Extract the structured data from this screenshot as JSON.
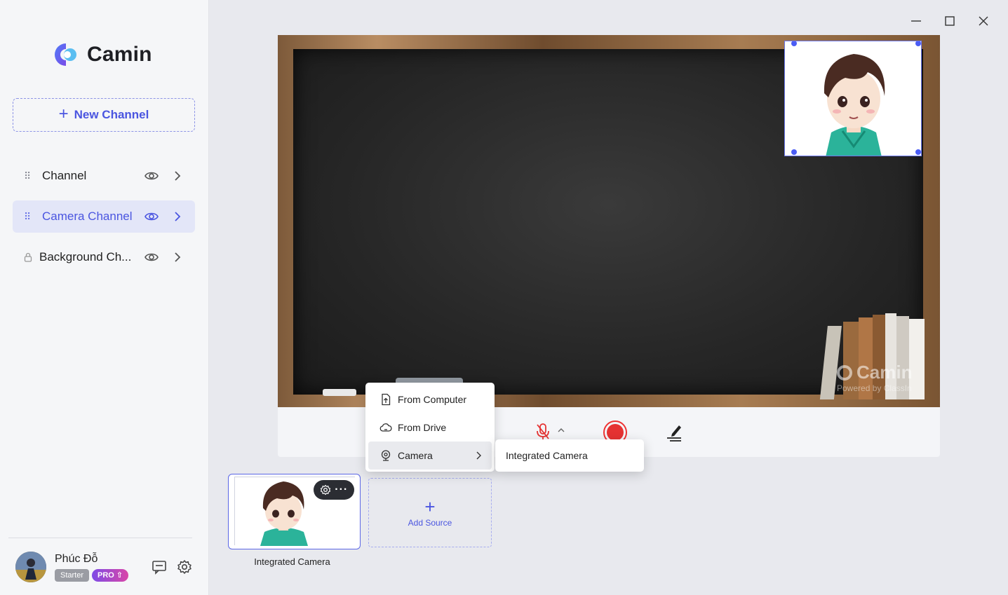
{
  "app": {
    "name": "Camin"
  },
  "sidebar": {
    "new_channel_label": "New Channel",
    "channels": [
      {
        "label": "Channel",
        "active": false,
        "locked": false
      },
      {
        "label": "Camera Channel",
        "active": true,
        "locked": false
      },
      {
        "label": "Background Ch...",
        "active": false,
        "locked": true
      }
    ],
    "user": {
      "name": "Phúc Đỗ",
      "plan": "Starter",
      "upgrade_badge": "PRO"
    }
  },
  "watermark": {
    "brand": "Camin",
    "tagline": "Powered by ClassIn"
  },
  "source_menu": {
    "items": [
      {
        "label": "From Computer",
        "icon": "file-upload-icon"
      },
      {
        "label": "From Drive",
        "icon": "cloud-icon"
      },
      {
        "label": "Camera",
        "icon": "webcam-icon"
      }
    ],
    "submenu_item": "Integrated Camera"
  },
  "sources": {
    "thumbnail_label": "Integrated Camera",
    "add_source_label": "Add Source"
  },
  "colors": {
    "accent": "#4a55e0",
    "record": "#e53232",
    "active_row": "#e3e6f8"
  }
}
